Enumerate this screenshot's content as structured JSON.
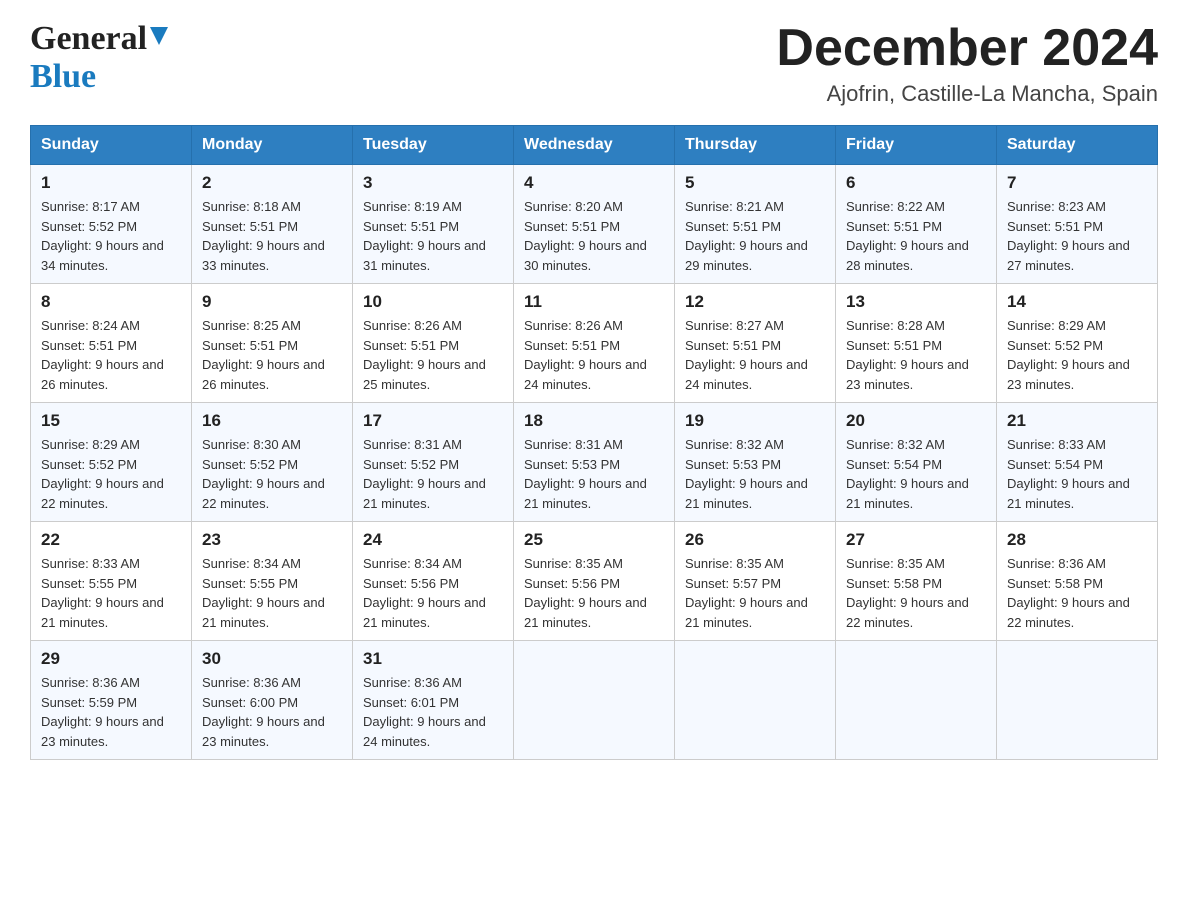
{
  "logo": {
    "line1": "General",
    "line2": "Blue"
  },
  "header": {
    "month": "December 2024",
    "location": "Ajofrin, Castille-La Mancha, Spain"
  },
  "weekdays": [
    "Sunday",
    "Monday",
    "Tuesday",
    "Wednesday",
    "Thursday",
    "Friday",
    "Saturday"
  ],
  "weeks": [
    [
      {
        "day": "1",
        "sunrise": "8:17 AM",
        "sunset": "5:52 PM",
        "daylight": "9 hours and 34 minutes."
      },
      {
        "day": "2",
        "sunrise": "8:18 AM",
        "sunset": "5:51 PM",
        "daylight": "9 hours and 33 minutes."
      },
      {
        "day": "3",
        "sunrise": "8:19 AM",
        "sunset": "5:51 PM",
        "daylight": "9 hours and 31 minutes."
      },
      {
        "day": "4",
        "sunrise": "8:20 AM",
        "sunset": "5:51 PM",
        "daylight": "9 hours and 30 minutes."
      },
      {
        "day": "5",
        "sunrise": "8:21 AM",
        "sunset": "5:51 PM",
        "daylight": "9 hours and 29 minutes."
      },
      {
        "day": "6",
        "sunrise": "8:22 AM",
        "sunset": "5:51 PM",
        "daylight": "9 hours and 28 minutes."
      },
      {
        "day": "7",
        "sunrise": "8:23 AM",
        "sunset": "5:51 PM",
        "daylight": "9 hours and 27 minutes."
      }
    ],
    [
      {
        "day": "8",
        "sunrise": "8:24 AM",
        "sunset": "5:51 PM",
        "daylight": "9 hours and 26 minutes."
      },
      {
        "day": "9",
        "sunrise": "8:25 AM",
        "sunset": "5:51 PM",
        "daylight": "9 hours and 26 minutes."
      },
      {
        "day": "10",
        "sunrise": "8:26 AM",
        "sunset": "5:51 PM",
        "daylight": "9 hours and 25 minutes."
      },
      {
        "day": "11",
        "sunrise": "8:26 AM",
        "sunset": "5:51 PM",
        "daylight": "9 hours and 24 minutes."
      },
      {
        "day": "12",
        "sunrise": "8:27 AM",
        "sunset": "5:51 PM",
        "daylight": "9 hours and 24 minutes."
      },
      {
        "day": "13",
        "sunrise": "8:28 AM",
        "sunset": "5:51 PM",
        "daylight": "9 hours and 23 minutes."
      },
      {
        "day": "14",
        "sunrise": "8:29 AM",
        "sunset": "5:52 PM",
        "daylight": "9 hours and 23 minutes."
      }
    ],
    [
      {
        "day": "15",
        "sunrise": "8:29 AM",
        "sunset": "5:52 PM",
        "daylight": "9 hours and 22 minutes."
      },
      {
        "day": "16",
        "sunrise": "8:30 AM",
        "sunset": "5:52 PM",
        "daylight": "9 hours and 22 minutes."
      },
      {
        "day": "17",
        "sunrise": "8:31 AM",
        "sunset": "5:52 PM",
        "daylight": "9 hours and 21 minutes."
      },
      {
        "day": "18",
        "sunrise": "8:31 AM",
        "sunset": "5:53 PM",
        "daylight": "9 hours and 21 minutes."
      },
      {
        "day": "19",
        "sunrise": "8:32 AM",
        "sunset": "5:53 PM",
        "daylight": "9 hours and 21 minutes."
      },
      {
        "day": "20",
        "sunrise": "8:32 AM",
        "sunset": "5:54 PM",
        "daylight": "9 hours and 21 minutes."
      },
      {
        "day": "21",
        "sunrise": "8:33 AM",
        "sunset": "5:54 PM",
        "daylight": "9 hours and 21 minutes."
      }
    ],
    [
      {
        "day": "22",
        "sunrise": "8:33 AM",
        "sunset": "5:55 PM",
        "daylight": "9 hours and 21 minutes."
      },
      {
        "day": "23",
        "sunrise": "8:34 AM",
        "sunset": "5:55 PM",
        "daylight": "9 hours and 21 minutes."
      },
      {
        "day": "24",
        "sunrise": "8:34 AM",
        "sunset": "5:56 PM",
        "daylight": "9 hours and 21 minutes."
      },
      {
        "day": "25",
        "sunrise": "8:35 AM",
        "sunset": "5:56 PM",
        "daylight": "9 hours and 21 minutes."
      },
      {
        "day": "26",
        "sunrise": "8:35 AM",
        "sunset": "5:57 PM",
        "daylight": "9 hours and 21 minutes."
      },
      {
        "day": "27",
        "sunrise": "8:35 AM",
        "sunset": "5:58 PM",
        "daylight": "9 hours and 22 minutes."
      },
      {
        "day": "28",
        "sunrise": "8:36 AM",
        "sunset": "5:58 PM",
        "daylight": "9 hours and 22 minutes."
      }
    ],
    [
      {
        "day": "29",
        "sunrise": "8:36 AM",
        "sunset": "5:59 PM",
        "daylight": "9 hours and 23 minutes."
      },
      {
        "day": "30",
        "sunrise": "8:36 AM",
        "sunset": "6:00 PM",
        "daylight": "9 hours and 23 minutes."
      },
      {
        "day": "31",
        "sunrise": "8:36 AM",
        "sunset": "6:01 PM",
        "daylight": "9 hours and 24 minutes."
      },
      null,
      null,
      null,
      null
    ]
  ],
  "labels": {
    "sunrise": "Sunrise: ",
    "sunset": "Sunset: ",
    "daylight": "Daylight: "
  }
}
